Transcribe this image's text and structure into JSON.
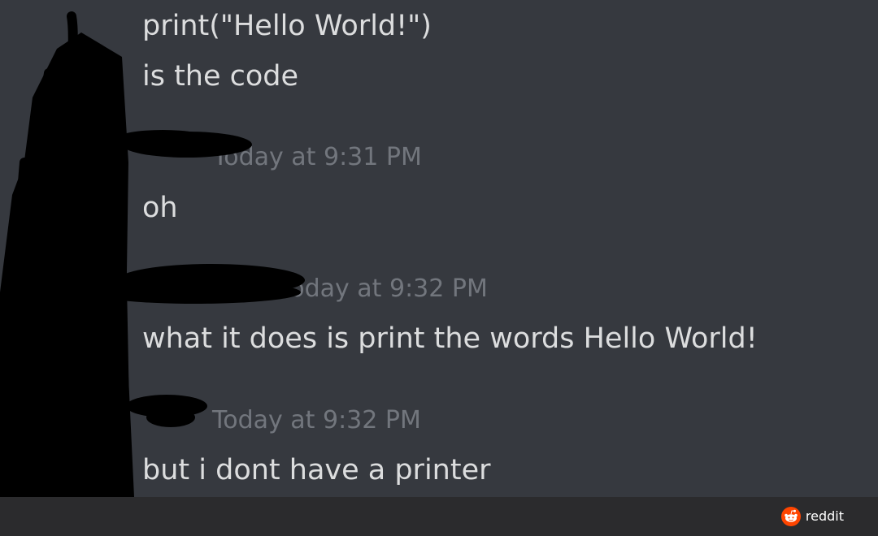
{
  "messages": [
    {
      "text": "print(\"Hello World!\")"
    },
    {
      "text": "is the code"
    },
    {
      "timestamp": "Today at 9:31 PM",
      "text": "oh"
    },
    {
      "timestamp": "Today at 9:32 PM",
      "text": "what it does is print the words Hello World!"
    },
    {
      "timestamp": "Today at 9:32 PM",
      "text": "but i dont have a printer"
    }
  ],
  "footer": {
    "brand": "reddit",
    "brand_color": "#ff4500"
  },
  "colors": {
    "background": "#36393f",
    "message_text": "#dcddde",
    "timestamp_text": "#72767d",
    "footer_bg": "#2b2b2d"
  }
}
